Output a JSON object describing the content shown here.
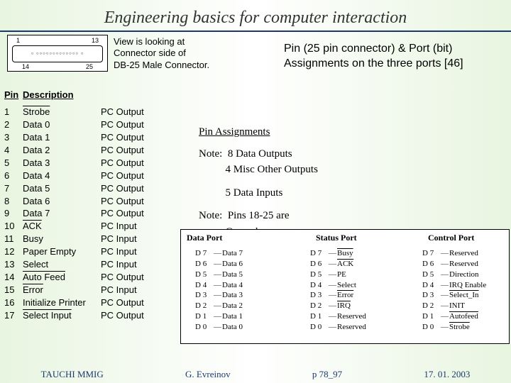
{
  "title": "Engineering basics for computer interaction",
  "connector": {
    "pin_tl": "1",
    "pin_tr": "13",
    "pin_bl": "14",
    "pin_br": "25"
  },
  "view_note": "View is looking at\nConnector side of\nDB-25 Male Connector.",
  "subtitle": "Pin (25 pin connector) & Port (bit)\nAssignments on the three ports [46]",
  "pin_table": {
    "h1": "Pin",
    "h2": "Description",
    "rows": [
      {
        "n": "1",
        "d": "Strobe",
        "dir": "PC Output",
        "ov": true
      },
      {
        "n": "2",
        "d": "Data 0",
        "dir": "PC Output"
      },
      {
        "n": "3",
        "d": "Data 1",
        "dir": "PC Output"
      },
      {
        "n": "4",
        "d": "Data 2",
        "dir": "PC Output"
      },
      {
        "n": "5",
        "d": "Data 3",
        "dir": "PC Output"
      },
      {
        "n": "6",
        "d": "Data 4",
        "dir": "PC Output"
      },
      {
        "n": "7",
        "d": "Data 5",
        "dir": "PC Output"
      },
      {
        "n": "8",
        "d": "Data 6",
        "dir": "PC Output"
      },
      {
        "n": "9",
        "d": "Data 7",
        "dir": "PC Output"
      },
      {
        "n": "10",
        "d": "ACK",
        "dir": "PC Input",
        "ov": true
      },
      {
        "n": "11",
        "d": "Busy",
        "dir": "PC Input"
      },
      {
        "n": "12",
        "d": "Paper Empty",
        "dir": "PC Input"
      },
      {
        "n": "13",
        "d": "Select",
        "dir": "PC Input"
      },
      {
        "n": "14",
        "d": "Auto Feed",
        "dir": "PC Output",
        "ov": true
      },
      {
        "n": "15",
        "d": "Error",
        "dir": "PC Input",
        "ov": true
      },
      {
        "n": "16",
        "d": "Initialize Printer",
        "dir": "PC Output"
      },
      {
        "n": "17",
        "d": "Select Input",
        "dir": "PC Output",
        "ov": true
      }
    ]
  },
  "assign_notes": {
    "title": "Pin Assignments",
    "n1": "Note:  8 Data Outputs",
    "n2": "          4 Misc Other Outputs",
    "n3": "          5 Data Inputs",
    "n4": "Note:  Pins 18-25 are",
    "n5": "          Ground"
  },
  "ports": {
    "h1": "Data Port",
    "h2": "Status Port",
    "h3": "Control Port",
    "data": [
      {
        "b": "D 7",
        "v": "Data 7"
      },
      {
        "b": "D 6",
        "v": "Data 6"
      },
      {
        "b": "D 5",
        "v": "Data 5"
      },
      {
        "b": "D 4",
        "v": "Data 4"
      },
      {
        "b": "D 3",
        "v": "Data 3"
      },
      {
        "b": "D 2",
        "v": "Data 2"
      },
      {
        "b": "D 1",
        "v": "Data 1"
      },
      {
        "b": "D 0",
        "v": "Data 0"
      }
    ],
    "status": [
      {
        "b": "D 7",
        "v": "Busy",
        "ov": true
      },
      {
        "b": "D 6",
        "v": "ACK",
        "ov": true
      },
      {
        "b": "D 5",
        "v": "PE"
      },
      {
        "b": "D 4",
        "v": "Select"
      },
      {
        "b": "D 3",
        "v": "Error",
        "ov": true
      },
      {
        "b": "D 2",
        "v": "IRQ",
        "ov": true
      },
      {
        "b": "D 1",
        "v": "Reserved"
      },
      {
        "b": "D 0",
        "v": "Reserved"
      }
    ],
    "control": [
      {
        "b": "D 7",
        "v": "Reserved"
      },
      {
        "b": "D 6",
        "v": "Reserved"
      },
      {
        "b": "D 5",
        "v": "Direction"
      },
      {
        "b": "D 4",
        "v": "IRQ Enable"
      },
      {
        "b": "D 3",
        "v": "Select_In",
        "ov": true
      },
      {
        "b": "D 2",
        "v": "INIT"
      },
      {
        "b": "D 1",
        "v": "Autofeed",
        "ov": true
      },
      {
        "b": "D 0",
        "v": "Strobe",
        "ov": true
      }
    ]
  },
  "footer": {
    "f1": "TAUCHI MMIG",
    "f2": "G. Evreinov",
    "f3": "p 78_97",
    "f4": "17. 01. 2003"
  }
}
